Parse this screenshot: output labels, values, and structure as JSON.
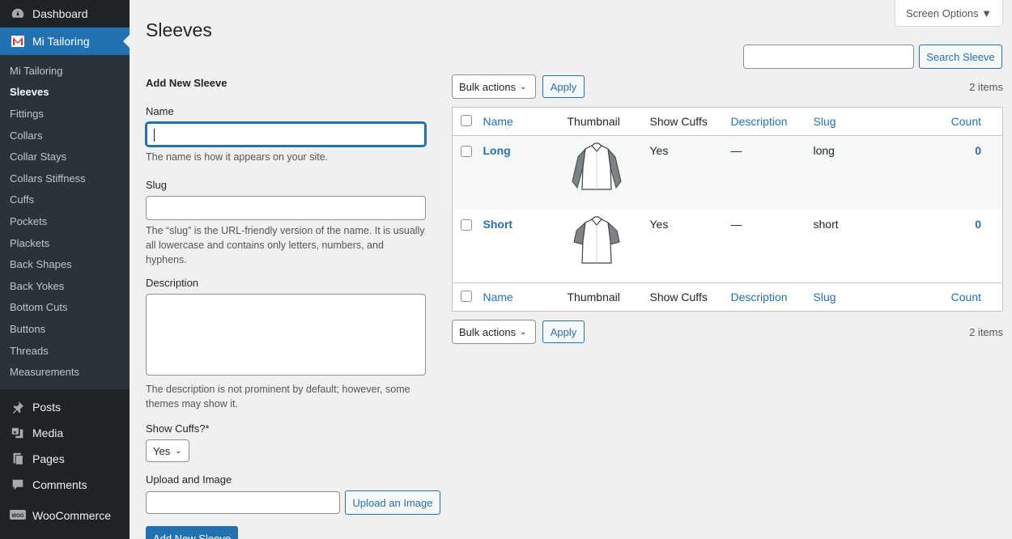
{
  "sidebar": {
    "top": [
      {
        "label": "Dashboard",
        "icon": "dashboard-icon"
      },
      {
        "label": "Mi Tailoring",
        "icon": "mi-tailoring-icon"
      }
    ],
    "submenu": [
      "Mi Tailoring",
      "Sleeves",
      "Fittings",
      "Collars",
      "Collar Stays",
      "Collars Stiffness",
      "Cuffs",
      "Pockets",
      "Plackets",
      "Back Shapes",
      "Back Yokes",
      "Bottom Cuts",
      "Buttons",
      "Threads",
      "Measurements"
    ],
    "menu": [
      {
        "label": "Posts",
        "icon": "pin-icon"
      },
      {
        "label": "Media",
        "icon": "media-icon"
      },
      {
        "label": "Pages",
        "icon": "pages-icon"
      },
      {
        "label": "Comments",
        "icon": "comment-icon"
      },
      {
        "label": "WooCommerce",
        "icon": "woo-icon"
      }
    ],
    "woo_badge": "WOO"
  },
  "header": {
    "title": "Sleeves",
    "screen_options": "Screen Options ▼"
  },
  "search": {
    "value": "",
    "button": "Search Sleeve"
  },
  "form": {
    "heading": "Add New Sleeve",
    "name_label": "Name",
    "name_help": "The name is how it appears on your site.",
    "slug_label": "Slug",
    "slug_help": "The “slug” is the URL-friendly version of the name. It is usually all lowercase and contains only letters, numbers, and hyphens.",
    "desc_label": "Description",
    "desc_help": "The description is not prominent by default; however, some themes may show it.",
    "cuffs_label": "Show Cuffs?*",
    "cuffs_value": "Yes",
    "upload_label": "Upload and Image",
    "upload_button": "Upload an Image",
    "submit": "Add New Sleeve"
  },
  "list": {
    "bulk_label": "Bulk actions",
    "apply": "Apply",
    "count_text": "2 items",
    "columns": {
      "name": "Name",
      "thumbnail": "Thumbnail",
      "cuffs": "Show Cuffs",
      "description": "Description",
      "slug": "Slug",
      "count": "Count"
    },
    "rows": [
      {
        "name": "Long",
        "cuffs": "Yes",
        "description": "—",
        "slug": "long",
        "count": "0"
      },
      {
        "name": "Short",
        "cuffs": "Yes",
        "description": "—",
        "slug": "short",
        "count": "0"
      }
    ]
  },
  "colors": {
    "accent": "#2271b1",
    "sidebar_bg": "#1d2327",
    "submenu_bg": "#2c3338"
  }
}
